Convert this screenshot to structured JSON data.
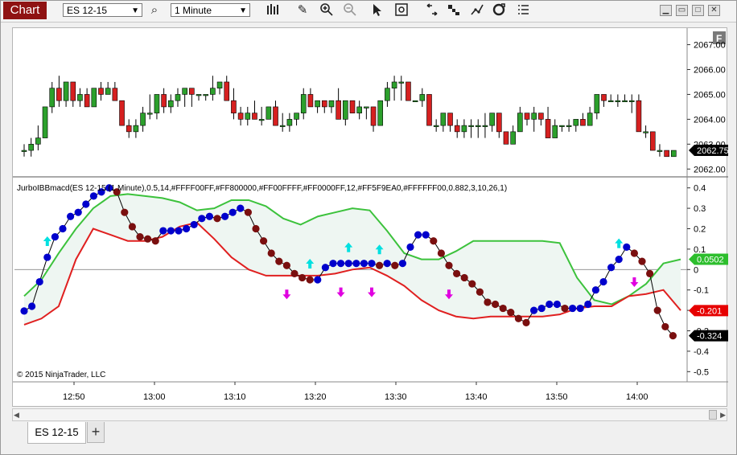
{
  "toolbar": {
    "chart_label": "Chart",
    "instrument": "ES 12-15",
    "interval": "1 Minute",
    "icons": [
      "search-icon",
      "bar-style-icon",
      "pencil-icon",
      "zoom-in-icon",
      "zoom-out-icon",
      "pointer-icon",
      "data-box-icon",
      "strategies-icon",
      "indicators-icon",
      "drawing-tools-icon",
      "refresh-icon",
      "properties-icon"
    ],
    "window_buttons": [
      "minimize-icon",
      "maximize-icon",
      "close-icon"
    ]
  },
  "price_panel": {
    "f_button": "F",
    "price_ticks": [
      "2067.00",
      "2066.00",
      "2065.00",
      "2064.00",
      "2063.00",
      "2062.00"
    ],
    "last_price": "2062.75",
    "last_price_color": "#000000"
  },
  "indicator_panel": {
    "label": "JurboIBBmacd(ES 12-15 (1 Minute),0.5,14,#FFFF00FF,#FF800000,#FF00FFFF,#FF0000FF,12,#FF5F9EA0,#FFFFFF00,0.882,3,10,26,1)",
    "ticks": [
      "0.4",
      "0.3",
      "0.2",
      "0.1",
      "0",
      "-0.1",
      "-0.2",
      "-0.3",
      "-0.4",
      "-0.5"
    ],
    "badges": [
      {
        "text": "0.0502",
        "color": "#2dbe2d"
      },
      {
        "text": "-0.201",
        "color": "#e60000"
      },
      {
        "text": "-0.324",
        "color": "#000000"
      }
    ],
    "copyright": "© 2015 NinjaTrader, LLC"
  },
  "time_axis": [
    "12:50",
    "13:00",
    "13:10",
    "13:20",
    "13:30",
    "13:40",
    "13:50",
    "14:00"
  ],
  "bottom_tabs": {
    "active": "ES 12-15",
    "add": "+"
  },
  "chart_data": {
    "type": "candlestick",
    "x_labels": [
      "12:50",
      "13:00",
      "13:10",
      "13:20",
      "13:30",
      "13:40",
      "13:50",
      "14:00"
    ],
    "price": {
      "ylim": [
        2061.75,
        2067.6
      ],
      "candles": [
        [
          2062.75,
          2063.0,
          2062.5,
          2062.75
        ],
        [
          2062.75,
          2063.25,
          2062.5,
          2063.0
        ],
        [
          2063.0,
          2063.75,
          2062.75,
          2063.25
        ],
        [
          2063.25,
          2064.5,
          2063.25,
          2064.5
        ],
        [
          2064.5,
          2065.5,
          2064.25,
          2065.25
        ],
        [
          2065.25,
          2065.75,
          2064.5,
          2064.75
        ],
        [
          2064.75,
          2065.5,
          2064.5,
          2065.5
        ],
        [
          2065.5,
          2065.5,
          2064.5,
          2064.75
        ],
        [
          2064.75,
          2065.25,
          2064.5,
          2065.0
        ],
        [
          2065.0,
          2065.25,
          2064.5,
          2064.5
        ],
        [
          2064.5,
          2065.25,
          2064.5,
          2065.25
        ],
        [
          2065.25,
          2065.5,
          2064.75,
          2065.0
        ],
        [
          2065.0,
          2065.5,
          2065.0,
          2065.25
        ],
        [
          2065.25,
          2065.5,
          2064.75,
          2064.75
        ],
        [
          2064.75,
          2064.75,
          2063.75,
          2063.75
        ],
        [
          2063.75,
          2064.0,
          2063.25,
          2063.5
        ],
        [
          2063.5,
          2064.0,
          2063.25,
          2063.75
        ],
        [
          2063.75,
          2064.5,
          2063.5,
          2064.25
        ],
        [
          2064.25,
          2065.0,
          2064.0,
          2064.25
        ],
        [
          2064.25,
          2065.0,
          2064.0,
          2065.0
        ],
        [
          2065.0,
          2065.25,
          2064.25,
          2064.5
        ],
        [
          2064.5,
          2065.0,
          2064.25,
          2064.75
        ],
        [
          2064.75,
          2065.25,
          2064.5,
          2065.0
        ],
        [
          2065.0,
          2065.25,
          2064.5,
          2065.25
        ],
        [
          2065.25,
          2065.25,
          2064.5,
          2065.0
        ],
        [
          2065.0,
          2065.0,
          2064.75,
          2065.0
        ],
        [
          2065.0,
          2065.0,
          2064.75,
          2065.0
        ],
        [
          2065.0,
          2065.75,
          2064.75,
          2065.25
        ],
        [
          2065.25,
          2065.5,
          2065.0,
          2065.5
        ],
        [
          2065.5,
          2065.75,
          2064.75,
          2064.75
        ],
        [
          2064.75,
          2065.25,
          2064.0,
          2064.25
        ],
        [
          2064.25,
          2064.5,
          2063.75,
          2064.0
        ],
        [
          2064.0,
          2064.5,
          2063.75,
          2064.25
        ],
        [
          2064.25,
          2064.75,
          2064.0,
          2064.0
        ],
        [
          2064.0,
          2064.5,
          2063.75,
          2064.0
        ],
        [
          2064.0,
          2064.5,
          2064.0,
          2064.5
        ],
        [
          2064.5,
          2064.75,
          2063.75,
          2063.75
        ],
        [
          2063.75,
          2064.25,
          2063.5,
          2063.75
        ],
        [
          2063.75,
          2064.25,
          2063.5,
          2064.0
        ],
        [
          2064.0,
          2064.25,
          2063.75,
          2064.25
        ],
        [
          2064.25,
          2065.25,
          2064.0,
          2065.0
        ],
        [
          2065.0,
          2065.25,
          2064.5,
          2064.5
        ],
        [
          2064.5,
          2064.75,
          2064.25,
          2064.75
        ],
        [
          2064.75,
          2064.75,
          2064.25,
          2064.5
        ],
        [
          2064.5,
          2064.75,
          2064.25,
          2064.75
        ],
        [
          2064.75,
          2065.25,
          2064.0,
          2064.0
        ],
        [
          2064.0,
          2064.75,
          2063.75,
          2064.75
        ],
        [
          2064.75,
          2064.75,
          2064.25,
          2064.25
        ],
        [
          2064.25,
          2064.75,
          2064.0,
          2064.5
        ],
        [
          2064.5,
          2064.5,
          2064.0,
          2064.5
        ],
        [
          2064.5,
          2064.5,
          2063.5,
          2063.75
        ],
        [
          2063.75,
          2064.75,
          2063.75,
          2064.75
        ],
        [
          2064.75,
          2065.5,
          2064.5,
          2065.25
        ],
        [
          2065.25,
          2065.75,
          2064.75,
          2065.5
        ],
        [
          2065.5,
          2065.75,
          2064.75,
          2065.5
        ],
        [
          2065.5,
          2065.5,
          2064.75,
          2064.75
        ],
        [
          2064.75,
          2064.75,
          2064.75,
          2064.75
        ],
        [
          2064.75,
          2065.25,
          2064.5,
          2065.0
        ],
        [
          2065.0,
          2065.0,
          2063.75,
          2063.75
        ],
        [
          2063.75,
          2064.0,
          2063.5,
          2063.75
        ],
        [
          2063.75,
          2064.25,
          2063.5,
          2064.25
        ],
        [
          2064.25,
          2064.25,
          2063.5,
          2063.75
        ],
        [
          2063.75,
          2064.0,
          2063.25,
          2063.5
        ],
        [
          2063.5,
          2064.0,
          2063.25,
          2063.75
        ],
        [
          2063.75,
          2064.0,
          2063.25,
          2063.75
        ],
        [
          2063.75,
          2064.0,
          2063.25,
          2063.75
        ],
        [
          2063.75,
          2064.25,
          2063.25,
          2063.75
        ],
        [
          2063.75,
          2064.25,
          2063.5,
          2064.25
        ],
        [
          2064.25,
          2064.25,
          2063.25,
          2063.5
        ],
        [
          2063.5,
          2063.5,
          2063.0,
          2063.0
        ],
        [
          2063.0,
          2063.75,
          2063.0,
          2063.5
        ],
        [
          2063.5,
          2064.5,
          2063.5,
          2064.25
        ],
        [
          2064.25,
          2064.25,
          2063.75,
          2064.0
        ],
        [
          2064.0,
          2064.5,
          2063.5,
          2064.25
        ],
        [
          2064.25,
          2064.25,
          2063.75,
          2064.0
        ],
        [
          2064.0,
          2064.5,
          2063.25,
          2063.25
        ],
        [
          2063.25,
          2064.0,
          2063.25,
          2063.75
        ],
        [
          2063.75,
          2063.75,
          2063.5,
          2063.75
        ],
        [
          2063.75,
          2064.0,
          2063.5,
          2063.75
        ],
        [
          2063.75,
          2064.0,
          2063.5,
          2064.0
        ],
        [
          2064.0,
          2064.25,
          2063.75,
          2063.75
        ],
        [
          2063.75,
          2064.5,
          2063.75,
          2064.25
        ],
        [
          2064.25,
          2065.0,
          2064.0,
          2065.0
        ],
        [
          2065.0,
          2065.0,
          2064.5,
          2064.75
        ],
        [
          2064.75,
          2065.0,
          2064.75,
          2064.75
        ],
        [
          2064.75,
          2065.0,
          2064.5,
          2064.75
        ],
        [
          2064.75,
          2065.0,
          2064.75,
          2064.75
        ],
        [
          2064.75,
          2065.0,
          2064.25,
          2064.75
        ],
        [
          2064.75,
          2065.0,
          2063.5,
          2063.5
        ],
        [
          2063.5,
          2063.75,
          2063.25,
          2063.5
        ],
        [
          2063.5,
          2063.5,
          2062.75,
          2062.75
        ],
        [
          2062.75,
          2063.0,
          2062.5,
          2062.75
        ],
        [
          2062.75,
          2062.75,
          2062.5,
          2062.5
        ],
        [
          2062.5,
          2062.75,
          2062.5,
          2062.75
        ]
      ]
    },
    "indicator": {
      "ylim": [
        -0.55,
        0.45
      ],
      "macd_dots": [
        -0.203,
        -0.18,
        -0.06,
        0.06,
        0.16,
        0.2,
        0.26,
        0.28,
        0.32,
        0.36,
        0.38,
        0.4,
        0.38,
        0.28,
        0.21,
        0.16,
        0.15,
        0.14,
        0.19,
        0.19,
        0.19,
        0.2,
        0.22,
        0.25,
        0.26,
        0.25,
        0.26,
        0.28,
        0.3,
        0.28,
        0.2,
        0.14,
        0.08,
        0.04,
        0.02,
        -0.02,
        -0.04,
        -0.05,
        -0.05,
        0.01,
        0.03,
        0.03,
        0.03,
        0.03,
        0.03,
        0.03,
        0.02,
        0.03,
        0.02,
        0.03,
        0.11,
        0.17,
        0.17,
        0.14,
        0.08,
        0.02,
        -0.02,
        -0.04,
        -0.07,
        -0.11,
        -0.16,
        -0.17,
        -0.19,
        -0.21,
        -0.24,
        -0.26,
        -0.2,
        -0.19,
        -0.17,
        -0.17,
        -0.19,
        -0.19,
        -0.19,
        -0.17,
        -0.1,
        -0.06,
        0.01,
        0.05,
        0.11,
        0.08,
        0.04,
        -0.02,
        -0.2,
        -0.28,
        -0.324
      ],
      "dot_colors_up": "#0000cc",
      "dot_colors_down": "#7a0f0f",
      "upper_band": [
        -0.13,
        -0.05,
        0.08,
        0.2,
        0.3,
        0.36,
        0.37,
        0.36,
        0.35,
        0.33,
        0.29,
        0.3,
        0.34,
        0.34,
        0.31,
        0.25,
        0.22,
        0.26,
        0.28,
        0.3,
        0.29,
        0.19,
        0.08,
        0.05,
        0.05,
        0.09,
        0.14,
        0.14,
        0.14,
        0.14,
        0.14,
        0.13,
        -0.04,
        -0.15,
        -0.17,
        -0.13,
        -0.07,
        0.03,
        0.05
      ],
      "lower_band": [
        -0.27,
        -0.24,
        -0.18,
        0.05,
        0.2,
        0.17,
        0.14,
        0.14,
        0.16,
        0.21,
        0.23,
        0.15,
        0.06,
        0.0,
        -0.03,
        -0.03,
        -0.03,
        -0.03,
        -0.02,
        0.0,
        0.01,
        -0.03,
        -0.08,
        -0.15,
        -0.2,
        -0.23,
        -0.24,
        -0.23,
        -0.23,
        -0.23,
        -0.23,
        -0.22,
        -0.19,
        -0.18,
        -0.18,
        -0.13,
        -0.12,
        -0.1,
        -0.2
      ],
      "up_arrows_color": "#00e0e0",
      "down_arrows_color": "#e000e0"
    }
  }
}
